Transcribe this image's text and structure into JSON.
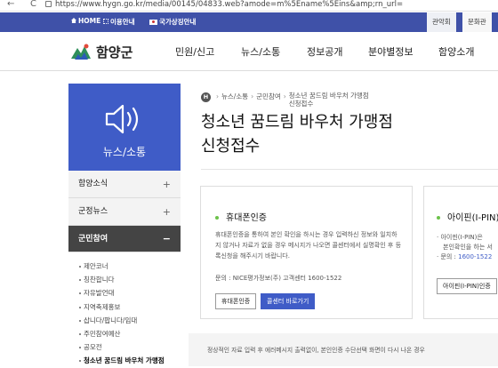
{
  "browser": {
    "back": "←",
    "reload": "C",
    "url": "https://www.hygn.go.kr/media/00145/04833.web?amode=m%5Ename%5Eins&amp;rn_url="
  },
  "util": {
    "home": "HOME",
    "guide": "이용안내",
    "nation": "국가상징안내",
    "right1": "관악회",
    "right2": "문화관"
  },
  "header": {
    "logo_text": "함양군",
    "gnb": [
      "민원/신고",
      "뉴스/소통",
      "정보공개",
      "분야별정보",
      "함양소개"
    ]
  },
  "sidebar": {
    "hero_title": "뉴스/소통",
    "items": [
      {
        "label": "함양소식",
        "sign": "+"
      },
      {
        "label": "군정뉴스",
        "sign": "+"
      },
      {
        "label": "군민참여",
        "sign": "−"
      }
    ],
    "sub_items": [
      "제안코너",
      "칭찬합니다",
      "자유발언대",
      "지역축제홍보",
      "삽니다/팝니다/임대",
      "주민참여예산",
      "공모전",
      "청소년 꿈드림 바우처 가맹점"
    ]
  },
  "content": {
    "bc_home": "H",
    "bc_1": "뉴스/소통",
    "bc_2": "군민참여",
    "bc_3a": "청소년 꿈드림 바우처 가맹점",
    "bc_3b": "신청접수",
    "title_line1": "청소년 꿈드림 바우처 가맹점",
    "title_line2": "신청접수"
  },
  "phone_auth": {
    "title": "휴대폰인증",
    "desc": "휴대폰인증을 통하여 본인 확인을 하시는 경우 입력하신 정보와 일치하지 않거나 자료가 없을 경우 메시지가 나오면 콜센터에서 실명확인 후 등록신청을 해주시기 바랍니다.",
    "contact": "문의 : NICE평가정보(주) 고객센터 1600-1522",
    "btn_auth": "휴대폰인증",
    "btn_call": "콜센터 바로가기"
  },
  "ipin_auth": {
    "title": "아이핀(I-PIN)",
    "line1": "· 아이핀(I-PIN)은",
    "line2": "본인확인을 하는 서",
    "contact_label": "· 문의 : ",
    "phone": "1600-1522",
    "btn": "아이핀(I-PIN)인증"
  },
  "notice": "정상적인 자료 입력 후 에러메시지 출력없이, 본인인증 수단선택 화면이 다시 나온 경우",
  "colors": {
    "brand_blue": "#3f5cc7",
    "util_blue": "#3f51a8",
    "accent_green": "#6cc24a"
  }
}
